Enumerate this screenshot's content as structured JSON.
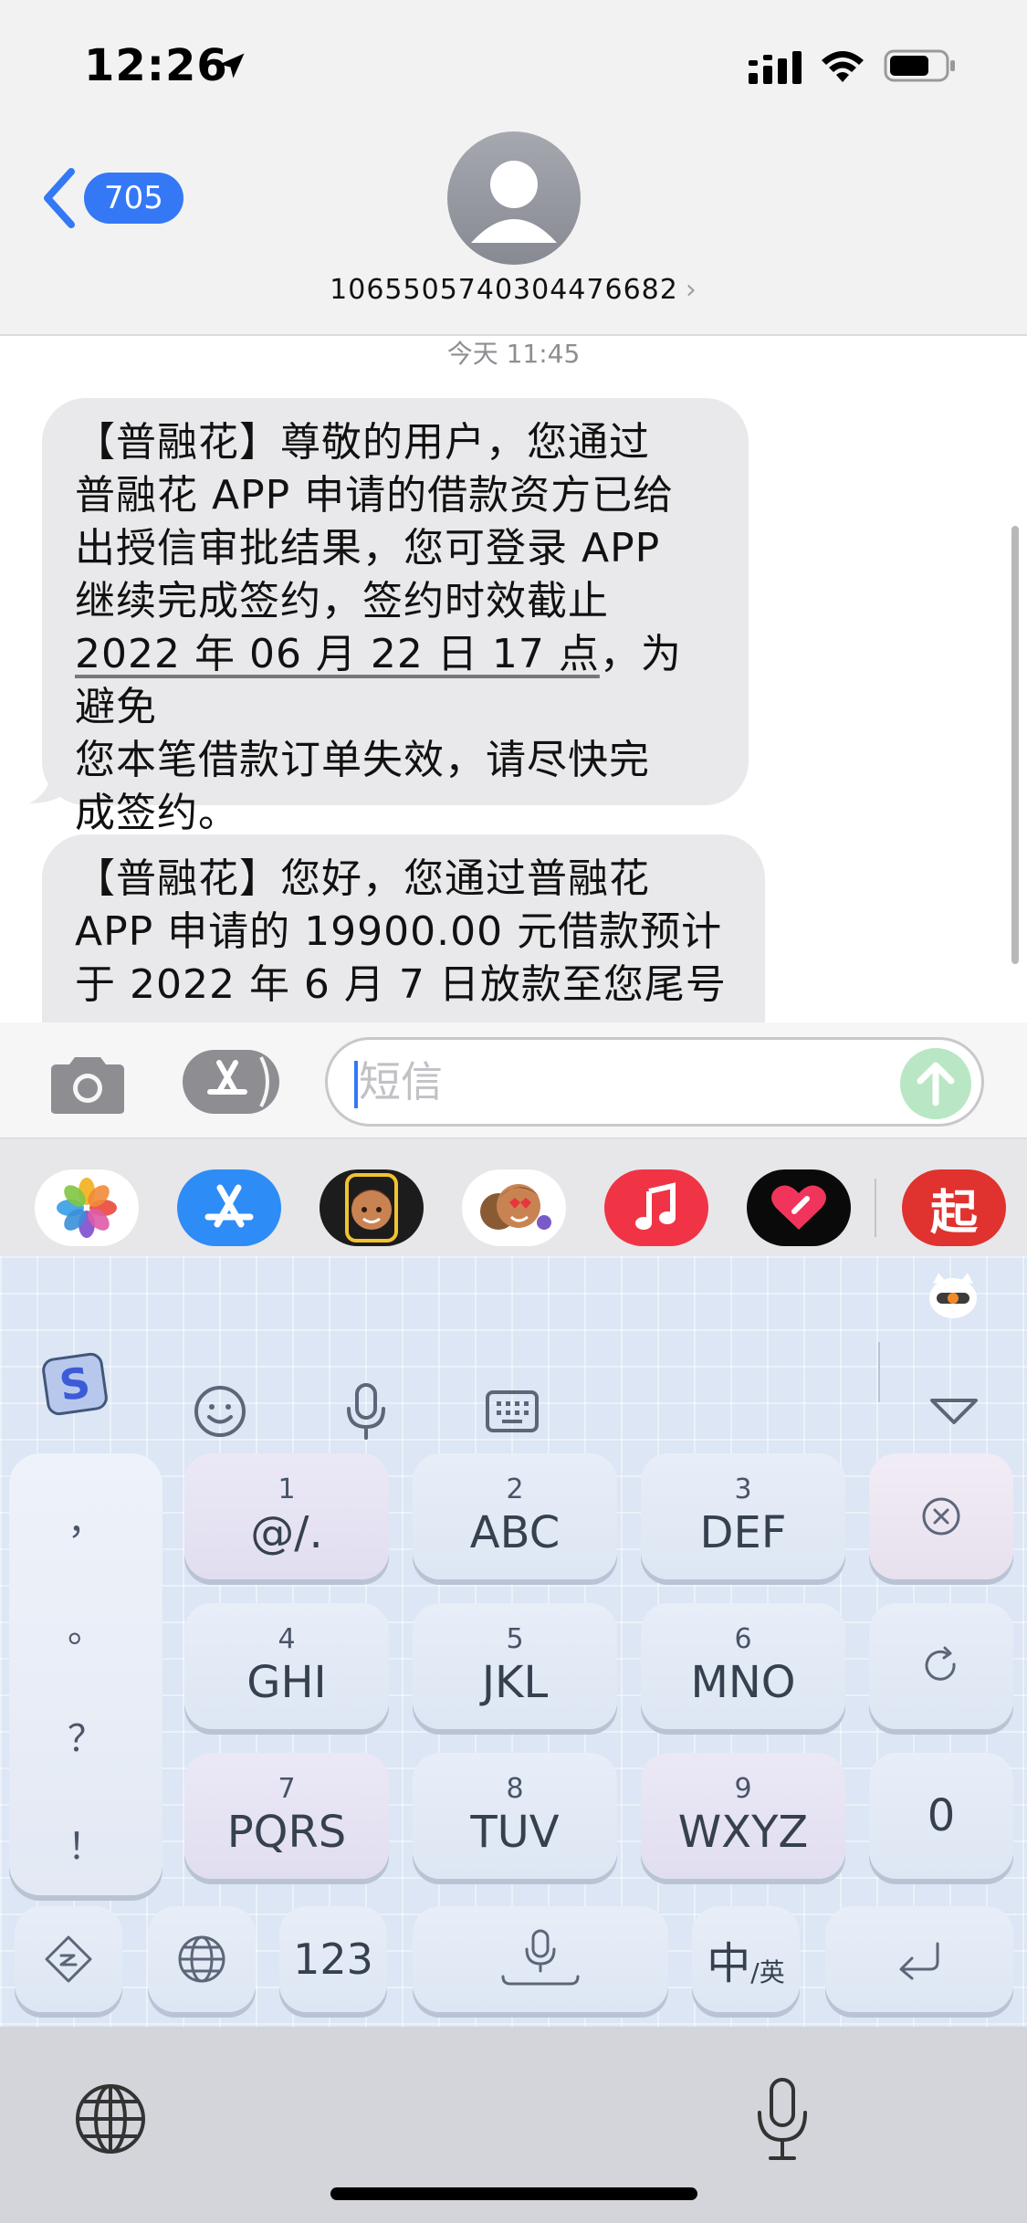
{
  "status_bar": {
    "time": "12:26",
    "icons": [
      "location-arrow-icon",
      "cellular-signal-icon",
      "wifi-icon",
      "battery-icon"
    ]
  },
  "header": {
    "back_count": "705",
    "contact_number": "106550574030447 6682",
    "contact_number_display": "1065505740304476682"
  },
  "conversation": {
    "timestamp": "今天 11:45",
    "messages": [
      {
        "lines": [
          "【普融花】尊敬的用户，您通过",
          "普融花 APP 申请的借款资方已给",
          "出授信审批结果，您可登录 APP",
          "继续完成签约，签约时效截止",
          "2022 年 06 月 22 日 17 点",
          "，为避免",
          "您本笔借款订单失效，请尽快完",
          "成签约。"
        ]
      },
      {
        "lines": [
          "【普融花】您好，您通过普融花",
          "APP 申请的 19900.00 元借款预计",
          "于 2022 年 6 月 7 日放款至您尾号"
        ]
      }
    ]
  },
  "input_bar": {
    "placeholder": "短信"
  },
  "app_strip": {
    "apps": [
      "photos-app",
      "app-store-app",
      "memoji-app",
      "animoji-app",
      "music-app",
      "digital-touch-app",
      "qidian-app"
    ],
    "qidian_label": "起"
  },
  "keyboard": {
    "punctuation": [
      "，",
      "。",
      "？",
      "！"
    ],
    "keys": [
      {
        "num": "1",
        "letters": "@/."
      },
      {
        "num": "2",
        "letters": "ABC"
      },
      {
        "num": "3",
        "letters": "DEF"
      },
      {
        "num": "4",
        "letters": "GHI"
      },
      {
        "num": "5",
        "letters": "JKL"
      },
      {
        "num": "6",
        "letters": "MNO"
      },
      {
        "num": "7",
        "letters": "PQRS"
      },
      {
        "num": "8",
        "letters": "TUV"
      },
      {
        "num": "9",
        "letters": "WXYZ"
      }
    ],
    "zero": "0",
    "numeric_label": "123",
    "lang_main": "中",
    "lang_sub": "/英"
  },
  "colors": {
    "accent_blue": "#3478f6",
    "bubble_gray": "#e9e9eb",
    "keyboard_bg": "#dce6f4",
    "send_green": "#b9e7c5"
  }
}
